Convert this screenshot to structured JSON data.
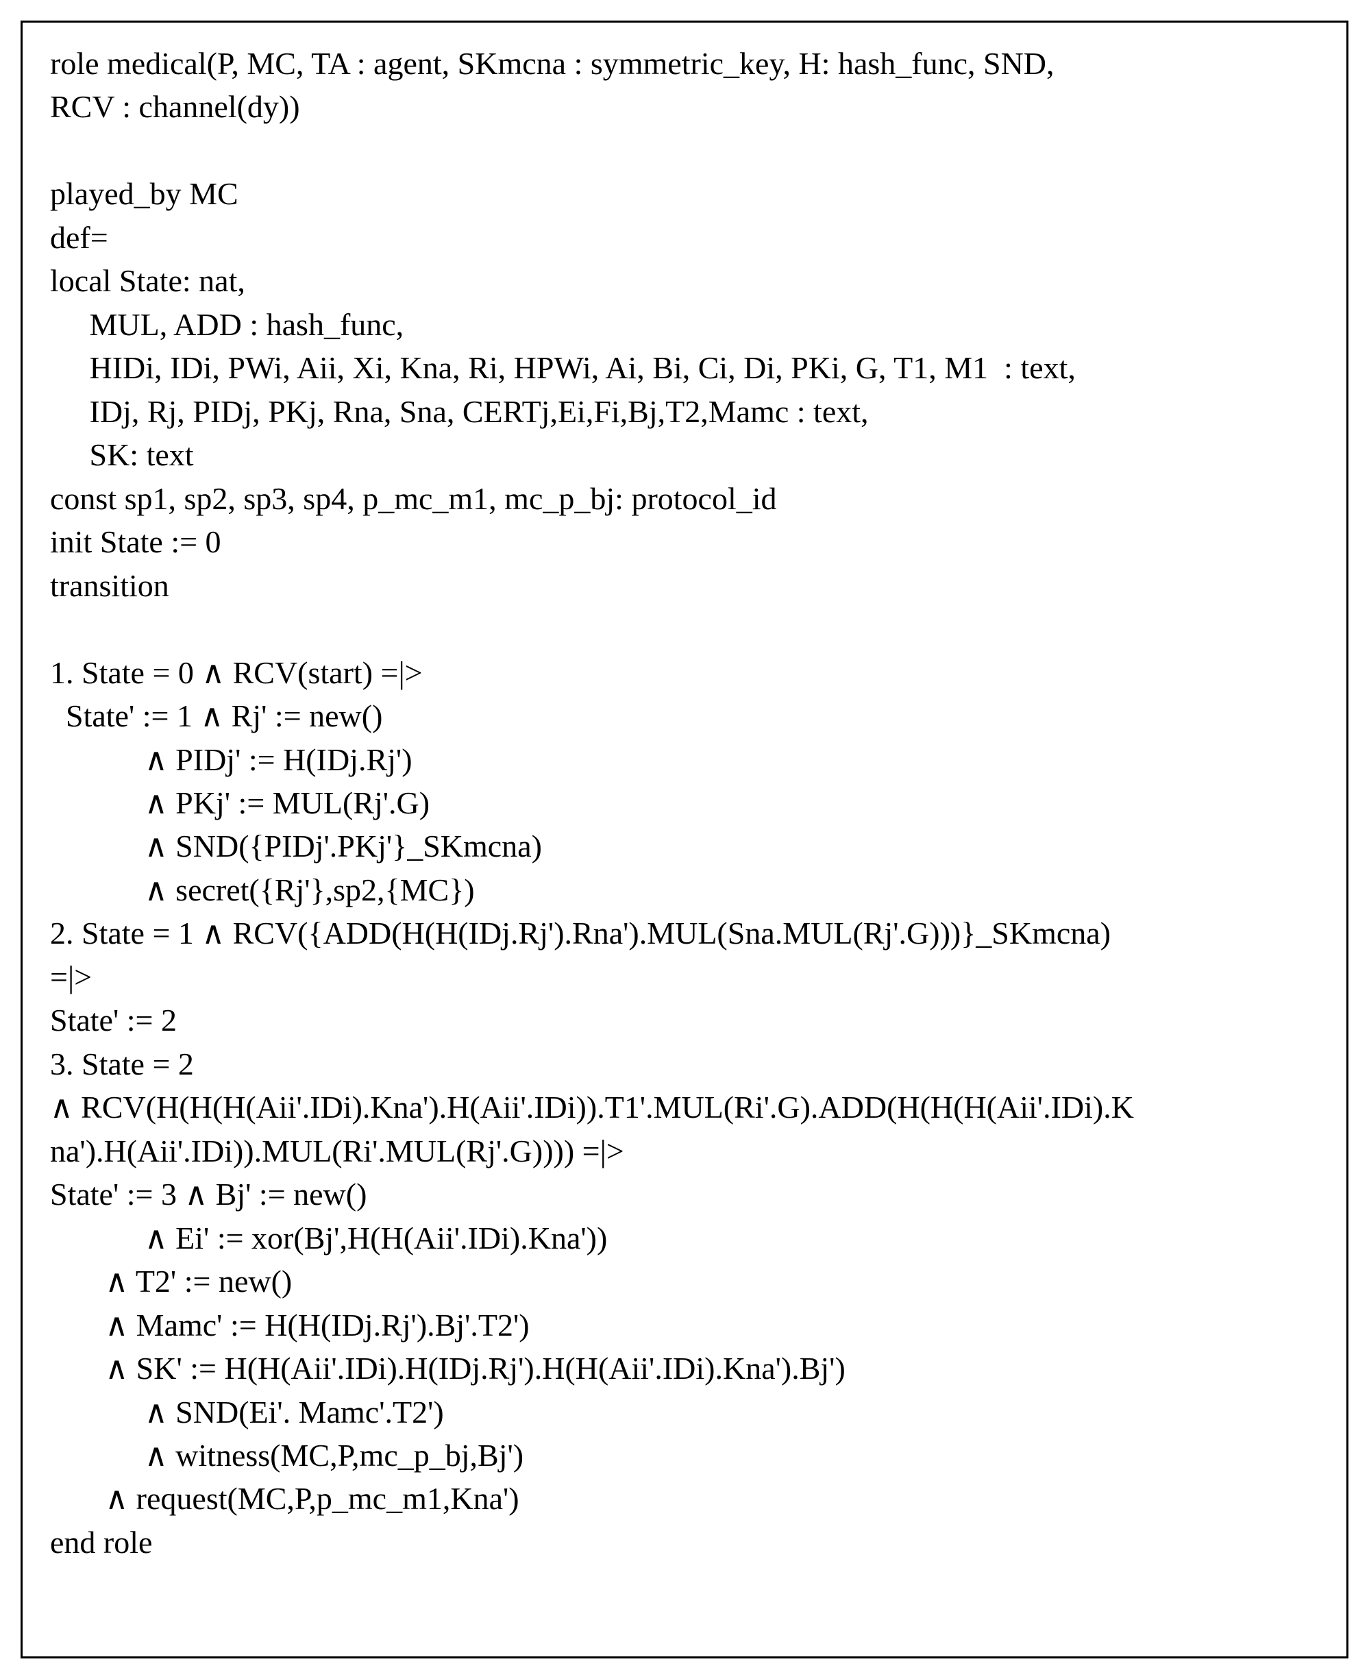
{
  "code": {
    "line01": "role medical(P, MC, TA : agent, SKmcna : symmetric_key, H: hash_func, SND,",
    "line02": "RCV : channel(dy))",
    "line03": "",
    "line04": "played_by MC",
    "line05": "def=",
    "line06": "local State: nat,",
    "line07": "     MUL, ADD : hash_func,",
    "line08": "     HIDi, IDi, PWi, Aii, Xi, Kna, Ri, HPWi, Ai, Bi, Ci, Di, PKi, G, T1, M1  : text,",
    "line09": "     IDj, Rj, PIDj, PKj, Rna, Sna, CERTj,Ei,Fi,Bj,T2,Mamc : text,",
    "line10": "     SK: text",
    "line11": "const sp1, sp2, sp3, sp4, p_mc_m1, mc_p_bj: protocol_id",
    "line12": "init State := 0",
    "line13": "transition",
    "line14": "",
    "line15": "1. State = 0 ∧ RCV(start) =|>",
    "line16": "  State' := 1 ∧ Rj' := new()",
    "line17": "            ∧ PIDj' := H(IDj.Rj')",
    "line18": "            ∧ PKj' := MUL(Rj'.G)",
    "line19": "            ∧ SND({PIDj'.PKj'}_SKmcna)",
    "line20": "            ∧ secret({Rj'},sp2,{MC})",
    "line21": "2. State = 1 ∧ RCV({ADD(H(H(IDj.Rj').Rna').MUL(Sna.MUL(Rj'.G)))}_SKmcna)",
    "line22": "=|>",
    "line23": "State' := 2",
    "line24": "3. State = 2",
    "line25": "∧ RCV(H(H(H(Aii'.IDi).Kna').H(Aii'.IDi)).T1'.MUL(Ri'.G).ADD(H(H(H(Aii'.IDi).K",
    "line26": "na').H(Aii'.IDi)).MUL(Ri'.MUL(Rj'.G)))) =|>",
    "line27": "State' := 3 ∧ Bj' := new()",
    "line28": "            ∧ Ei' := xor(Bj',H(H(Aii'.IDi).Kna'))",
    "line29": "       ∧ T2' := new()",
    "line30": "       ∧ Mamc' := H(H(IDj.Rj').Bj'.T2')",
    "line31": "       ∧ SK' := H(H(Aii'.IDi).H(IDj.Rj').H(H(Aii'.IDi).Kna').Bj')",
    "line32": "            ∧ SND(Ei'. Mamc'.T2')",
    "line33": "            ∧ witness(MC,P,mc_p_bj,Bj')",
    "line34": "       ∧ request(MC,P,p_mc_m1,Kna')",
    "line35": "end role"
  }
}
